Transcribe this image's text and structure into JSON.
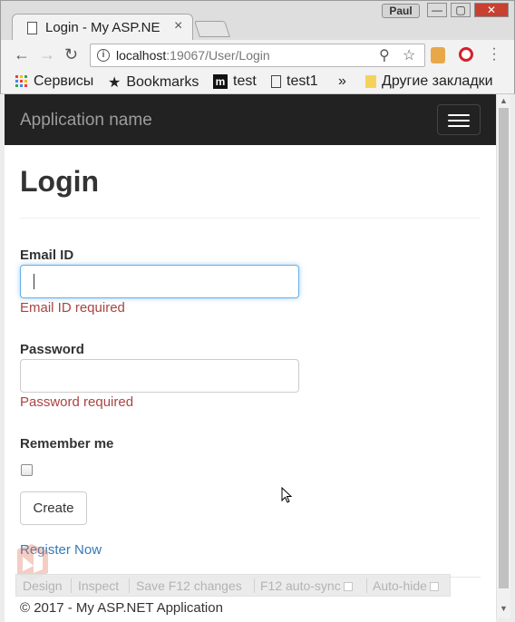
{
  "browser": {
    "tab_title": "Login - My ASP.NE",
    "tab_close": "×",
    "user_name": "Paul",
    "window_controls": {
      "minimize": "—",
      "maximize": "▢",
      "close": "✕"
    },
    "url_host": "localhost",
    "url_path": ":19067/User/Login",
    "bookmarks": [
      {
        "label": "Сервисы",
        "icon": "apps-grid-icon"
      },
      {
        "label": "Bookmarks",
        "icon": "star-icon"
      },
      {
        "label": "test",
        "icon": "m-logo-icon"
      },
      {
        "label": "test1",
        "icon": "page-icon"
      }
    ],
    "bookmarks_overflow": "»",
    "other_bookmarks": "Другие закладки"
  },
  "app": {
    "brand": "Application name"
  },
  "login": {
    "title": "Login",
    "email_label": "Email ID",
    "email_value": "",
    "email_error": "Email ID required",
    "password_label": "Password",
    "password_value": "",
    "password_error": "Password required",
    "remember_label": "Remember me",
    "remember_checked": false,
    "create_button": "Create",
    "register_link": "Register Now"
  },
  "browser_link_bar": {
    "design": "Design",
    "inspect": "Inspect",
    "save": "Save F12 changes",
    "autosync": "F12 auto-sync",
    "autohide": "Auto-hide"
  },
  "footer": {
    "text": "© 2017 - My ASP.NET Application"
  }
}
